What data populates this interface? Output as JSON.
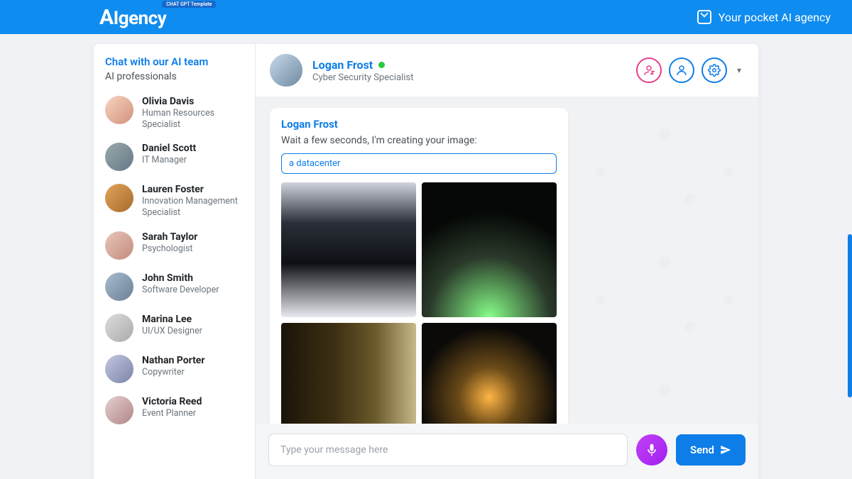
{
  "brand": {
    "name": "AIgency",
    "badge": "CHAT GPT Template"
  },
  "tagline": "Your pocket AI agency",
  "sidebar": {
    "title": "Chat with our AI team",
    "subtitle": "AI professionals",
    "members": [
      {
        "name": "Olivia Davis",
        "role": "Human Resources Specialist"
      },
      {
        "name": "Daniel Scott",
        "role": "IT Manager"
      },
      {
        "name": "Lauren Foster",
        "role": "Innovation Management Specialist"
      },
      {
        "name": "Sarah Taylor",
        "role": "Psychologist"
      },
      {
        "name": "John Smith",
        "role": "Software Developer"
      },
      {
        "name": "Marina Lee",
        "role": "UI/UX Designer"
      },
      {
        "name": "Nathan Porter",
        "role": "Copywriter"
      },
      {
        "name": "Victoria Reed",
        "role": "Event Planner"
      }
    ]
  },
  "chat": {
    "user": {
      "name": "Logan Frost",
      "role": "Cyber Security Specialist",
      "status": "online"
    },
    "message": {
      "sender": "Logan Frost",
      "text": "Wait a few seconds, I'm creating your image:",
      "prompt": "a datacenter"
    },
    "input_placeholder": "Type your message here",
    "send_label": "Send"
  }
}
